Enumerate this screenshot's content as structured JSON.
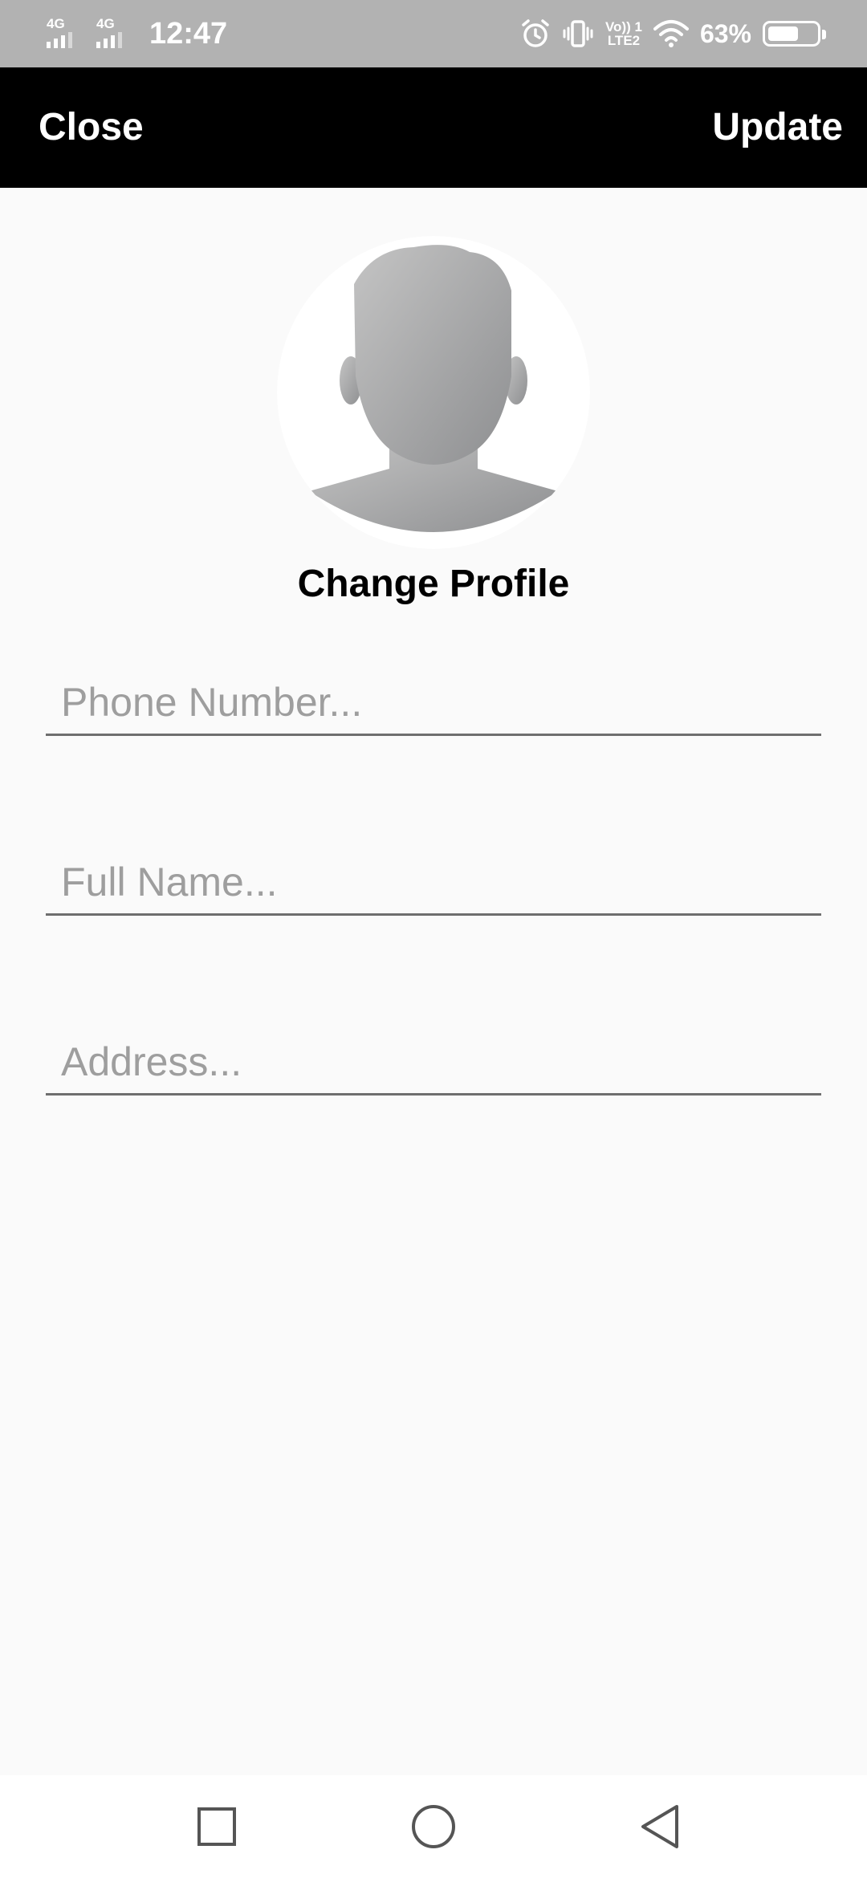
{
  "status_bar": {
    "sim1_label": "4G",
    "sim2_label": "4G",
    "time": "12:47",
    "volte_line1": "Vo)) 1",
    "volte_line2": "LTE2",
    "battery_percent": "63%",
    "battery_level": 0.63,
    "icons": [
      "signal-icon",
      "signal-icon",
      "alarm-icon",
      "vibrate-icon",
      "volte-icon",
      "wifi-icon",
      "battery-icon"
    ]
  },
  "app_bar": {
    "close_label": "Close",
    "update_label": "Update",
    "background": "#000000",
    "text_color": "#ffffff"
  },
  "profile": {
    "change_label": "Change Profile",
    "avatar_icon": "default-user-avatar"
  },
  "form": {
    "phone_placeholder": "Phone Number...",
    "phone_value": "",
    "name_placeholder": "Full Name...",
    "name_value": "",
    "address_placeholder": "Address...",
    "address_value": ""
  },
  "nav_bar": {
    "icons": [
      "recents-square-icon",
      "home-circle-icon",
      "back-triangle-icon"
    ]
  }
}
